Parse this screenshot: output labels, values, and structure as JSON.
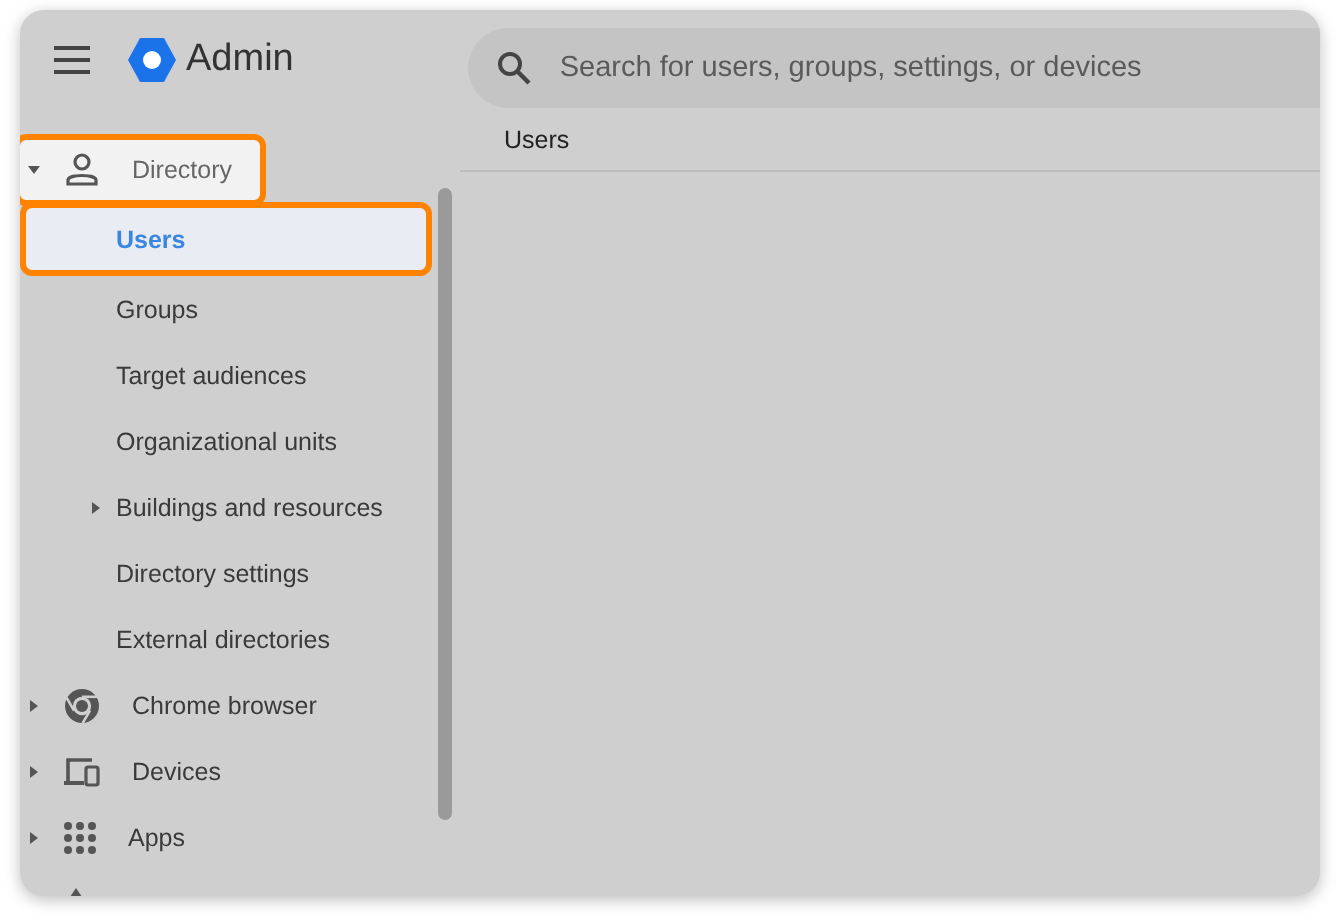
{
  "header": {
    "app_name": "Admin",
    "search": {
      "placeholder": "Search for users, groups, settings, or devices"
    }
  },
  "sidebar": {
    "items": [
      {
        "label": "Directory",
        "kind": "person",
        "expanded": true,
        "highlighted": true,
        "children": [
          {
            "label": "Users",
            "selected": true,
            "highlighted": true
          },
          {
            "label": "Groups",
            "selected": false,
            "highlighted": false
          },
          {
            "label": "Target audiences",
            "selected": false,
            "highlighted": false
          },
          {
            "label": "Organizational units",
            "selected": false,
            "highlighted": false
          },
          {
            "label": "Buildings and resources",
            "selected": false,
            "highlighted": false,
            "expanded": false
          },
          {
            "label": "Directory settings",
            "selected": false,
            "highlighted": false
          },
          {
            "label": "External directories",
            "selected": false,
            "highlighted": false
          }
        ]
      },
      {
        "label": "Chrome browser",
        "kind": "chrome",
        "expanded": false,
        "highlighted": false
      },
      {
        "label": "Devices",
        "kind": "devices",
        "expanded": false,
        "highlighted": false
      },
      {
        "label": "Apps",
        "kind": "apps",
        "expanded": false,
        "highlighted": false
      }
    ]
  },
  "main": {
    "breadcrumb": "Users"
  }
}
